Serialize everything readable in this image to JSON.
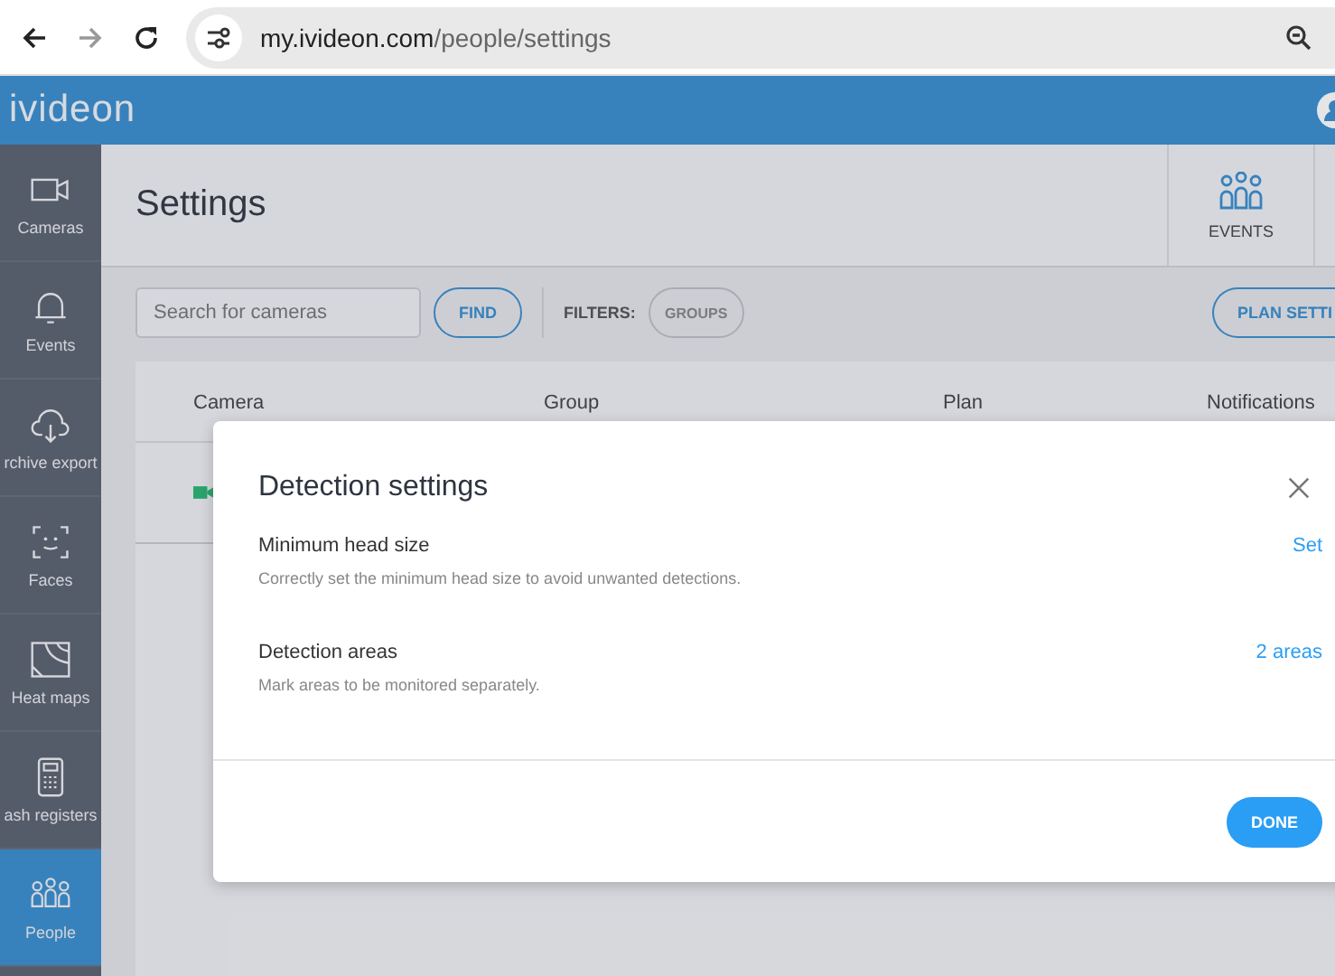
{
  "browser": {
    "url_host": "my.ivideon.com",
    "url_path": "/people/settings"
  },
  "app_header": {
    "logo": "ivideon"
  },
  "sidebar": {
    "items": [
      {
        "label": "Cameras",
        "selected": false
      },
      {
        "label": "Events",
        "selected": false
      },
      {
        "label": "rchive export",
        "selected": false
      },
      {
        "label": "Faces",
        "selected": false
      },
      {
        "label": "Heat maps",
        "selected": false
      },
      {
        "label": "ash registers",
        "selected": false
      },
      {
        "label": "People",
        "selected": true
      }
    ]
  },
  "page": {
    "title": "Settings",
    "header_tabs": [
      {
        "label": "EVENTS",
        "selected": false
      }
    ]
  },
  "toolbar": {
    "search": {
      "placeholder": "Search for cameras"
    },
    "find_button": "FIND",
    "filters_label": "FILTERS:",
    "filters": [
      "GROUPS"
    ],
    "plan_button": "PLAN SETTI"
  },
  "table": {
    "columns": [
      "Camera",
      "Group",
      "Plan",
      "Notifications"
    ],
    "rows": [
      {
        "online": true
      }
    ]
  },
  "dialog": {
    "title": "Detection settings",
    "items": [
      {
        "title": "Minimum head size",
        "description": "Correctly set the minimum head size to avoid unwanted detections.",
        "action": "Set"
      },
      {
        "title": "Detection areas",
        "description": "Mark areas to be monitored separately.",
        "action": "2 areas"
      }
    ],
    "done_button": "DONE"
  }
}
